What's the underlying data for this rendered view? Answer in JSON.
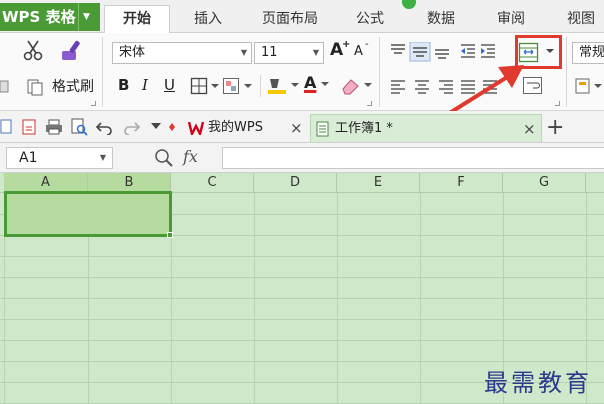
{
  "app": {
    "name": "WPS 表格"
  },
  "menu": {
    "tabs": [
      "开始",
      "插入",
      "页面布局",
      "公式",
      "数据",
      "审阅",
      "视图"
    ],
    "active_tab": "开始"
  },
  "ribbon": {
    "font_name": "宋体",
    "font_size": "11",
    "format_painter_label": "格式刷",
    "number_format": "常规",
    "bold_label": "B",
    "italic_label": "I",
    "underline_label": "U",
    "grow_font_label": "A",
    "shrink_font_label": "A",
    "font_color_label": "A"
  },
  "doc_tabs": {
    "home_tab_label": "我的WPS",
    "workbook_tab_label": "工作簿1 *",
    "close_symbol": "×",
    "new_tab_symbol": "+"
  },
  "formula_bar": {
    "cell_ref": "A1",
    "fx_label": "fx"
  },
  "sheet": {
    "columns": [
      "A",
      "B",
      "C",
      "D",
      "E",
      "F",
      "G"
    ],
    "selected_columns": [
      "A",
      "B"
    ]
  },
  "watermark": "最需教育",
  "colors": {
    "accent": "#4a9b36",
    "grid_bg": "#cfe8c9",
    "highlight": "#e03a2e"
  },
  "icons": [
    "cut-icon",
    "format-painter-icon",
    "paste-icon",
    "border-icon",
    "fill-color-icon",
    "font-color-icon",
    "eraser-icon",
    "align-top-icon",
    "align-middle-icon",
    "align-bottom-icon",
    "align-left-icon",
    "align-center-icon",
    "align-right-icon",
    "justify-icon",
    "indent-decrease-icon",
    "indent-increase-icon",
    "merge-center-icon",
    "wrap-text-icon",
    "conditional-format-icon",
    "new-icon",
    "open-icon",
    "print-icon",
    "print-preview-icon",
    "undo-icon",
    "redo-icon",
    "customize-icon",
    "wps-logo-icon",
    "sheet-icon",
    "zoom-icon",
    "red-arrow-icon"
  ]
}
